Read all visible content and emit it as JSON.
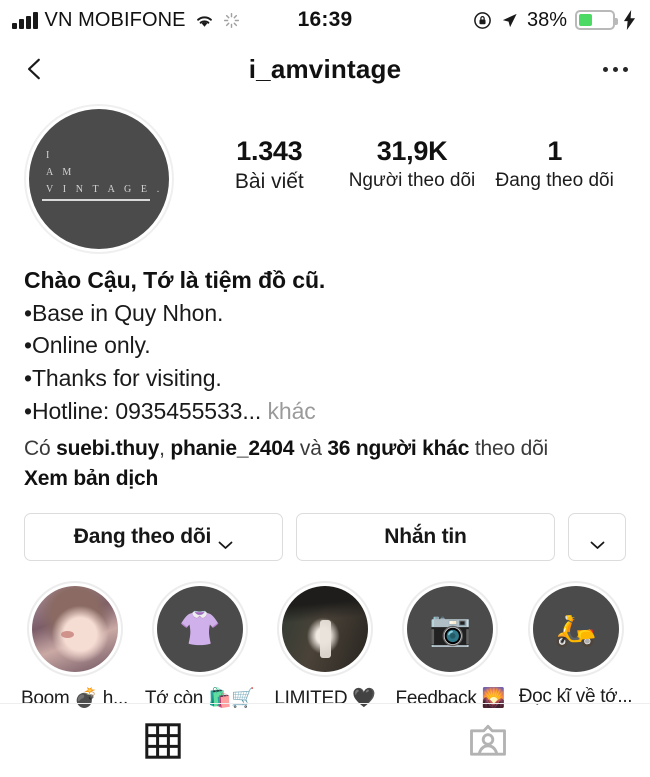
{
  "status_bar": {
    "carrier": "VN MOBIFONE",
    "time": "16:39",
    "battery_percent": "38%",
    "icons": [
      "signal-bars-icon",
      "wifi-icon",
      "spinner-icon",
      "lock-rotation-icon",
      "location-arrow-icon",
      "battery-icon",
      "charging-bolt-icon"
    ]
  },
  "nav": {
    "title": "i_amvintage",
    "back_icon": "back-chevron-icon",
    "more_icon": "more-options-icon"
  },
  "profile": {
    "avatar_lines": [
      "I",
      "A M",
      "V I N T A G E ."
    ],
    "stats": [
      {
        "number": "1.343",
        "label": "Bài viết"
      },
      {
        "number": "31,9K",
        "label": "Người theo dõi"
      },
      {
        "number": "1",
        "label": "Đang theo dõi"
      }
    ],
    "bio_name": "Chào Cậu, Tớ là tiệm đồ cũ.",
    "bio_lines": [
      "•Base in Quy Nhon.",
      "•Online only.",
      "•Thanks for visiting."
    ],
    "bio_last_line": "•Hotline: 0935455533...",
    "more_label": "khác",
    "followed_by": {
      "prefix": "Có ",
      "user1": "suebi.thuy",
      "separator": ", ",
      "user2": "phanie_2404",
      "middle": " và ",
      "others": "36 người khác",
      "suffix": " theo dõi"
    },
    "translate_label": "Xem bản dịch"
  },
  "actions": {
    "follow_label": "Đang theo dõi",
    "message_label": "Nhắn tin",
    "dropdown_icon": "chevron-down-icon"
  },
  "highlights": [
    {
      "label": "Boom 💣 h...",
      "thumb": "photo-child"
    },
    {
      "label": "Tớ còn 🛍️🛒",
      "thumb": "emoji",
      "emoji": "👚"
    },
    {
      "label": "LIMITED 🖤",
      "thumb": "photo-store"
    },
    {
      "label": "Feedback 🌄",
      "thumb": "emoji",
      "emoji": "📷"
    },
    {
      "label": "Đọc kĩ về tớ...",
      "thumb": "emoji",
      "emoji": "🛵"
    }
  ],
  "tabbar": {
    "grid_icon": "grid-posts-icon",
    "tagged_icon": "tagged-photos-icon"
  },
  "colors": {
    "text": "#111111",
    "muted": "#9a9a9a",
    "border": "#dcdcdc",
    "avatar_bg": "#4b4b4b",
    "battery_green": "#4cd964"
  }
}
